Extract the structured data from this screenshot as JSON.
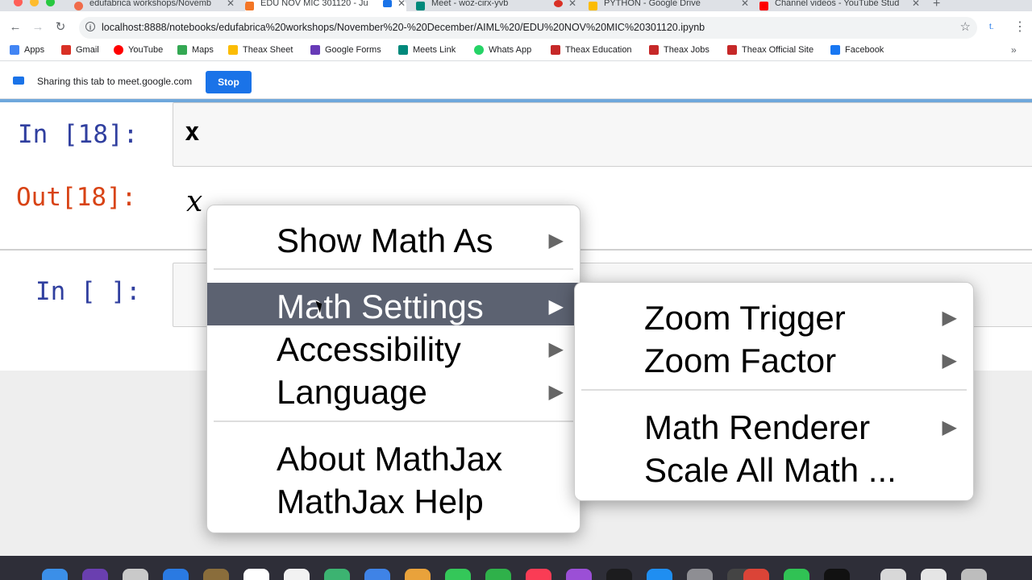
{
  "browser": {
    "tabs": [
      {
        "title": "edufabrica workshops/Novemb",
        "fav_color": "#f06b4a",
        "close": "✕",
        "active": false
      },
      {
        "title": "EDU NOV MIC 301120 - Ju",
        "fav_color": "#f37626",
        "close": "✕",
        "active": true
      },
      {
        "title": "Meet - woz-cirx-yvb",
        "fav_color": "#00897b",
        "close": "✕",
        "active": false
      },
      {
        "title": "PYTHON - Google Drive",
        "fav_color": "#fbbc04",
        "close": "✕",
        "active": false
      },
      {
        "title": "Channel videos - YouTube Stud",
        "fav_color": "#ff0000",
        "close": "✕",
        "active": false
      }
    ],
    "new_tab": "+",
    "url": "localhost:8888/notebooks/edufabrica%20workshops/November%20-%20December/AIML%20/EDU%20NOV%20MIC%20301120.ipynb",
    "bookmarks": [
      {
        "label": "Apps",
        "icon": "apps-grid-icon",
        "color": "#4285f4"
      },
      {
        "label": "Gmail",
        "icon": "gmail-icon",
        "color": "#d93025"
      },
      {
        "label": "YouTube",
        "icon": "youtube-icon",
        "color": "#ff0000"
      },
      {
        "label": "Maps",
        "icon": "maps-icon",
        "color": "#34a853"
      },
      {
        "label": "Theax Sheet",
        "icon": "drive-icon",
        "color": "#fbbc04"
      },
      {
        "label": "Google Forms",
        "icon": "forms-icon",
        "color": "#673ab7"
      },
      {
        "label": "Meets Link",
        "icon": "meet-icon",
        "color": "#00897b"
      },
      {
        "label": "Whats App",
        "icon": "whatsapp-icon",
        "color": "#25d366"
      },
      {
        "label": "Theax Education",
        "icon": "theax-icon",
        "color": "#c62828"
      },
      {
        "label": "Theax Jobs",
        "icon": "theax-icon",
        "color": "#c62828"
      },
      {
        "label": "Theax Official Site",
        "icon": "theax-icon",
        "color": "#c62828"
      },
      {
        "label": "Facebook",
        "icon": "facebook-icon",
        "color": "#1877f2"
      }
    ],
    "bookmarks_more": "»"
  },
  "share_bar": {
    "text": "Sharing this tab to meet.google.com",
    "stop_label": "Stop"
  },
  "notebook": {
    "cell1_prompt": "In [18]:",
    "cell1_code": "x",
    "cell1_out_prompt": "Out[18]:",
    "cell1_out_math": "x",
    "cell2_prompt": "In [ ]:"
  },
  "mathjax_menu": {
    "items": [
      {
        "label": "Show Math As",
        "submenu": true
      },
      {
        "label": "Math Settings",
        "submenu": true,
        "highlighted": true
      },
      {
        "label": "Accessibility",
        "submenu": true
      },
      {
        "label": "Language",
        "submenu": true
      },
      {
        "label": "About MathJax",
        "submenu": false
      },
      {
        "label": "MathJax Help",
        "submenu": false
      }
    ],
    "arrow": "▶"
  },
  "math_settings_submenu": {
    "items": [
      {
        "label": "Zoom Trigger",
        "submenu": true
      },
      {
        "label": "Zoom Factor",
        "submenu": true
      },
      {
        "label": "Math Renderer",
        "submenu": true
      },
      {
        "label": "Scale All Math ...",
        "submenu": false
      }
    ]
  },
  "colors": {
    "in_prompt": "#303f9f",
    "out_prompt": "#d84315",
    "menu_highlight": "#5c6271",
    "share_stop": "#1a73e8"
  }
}
